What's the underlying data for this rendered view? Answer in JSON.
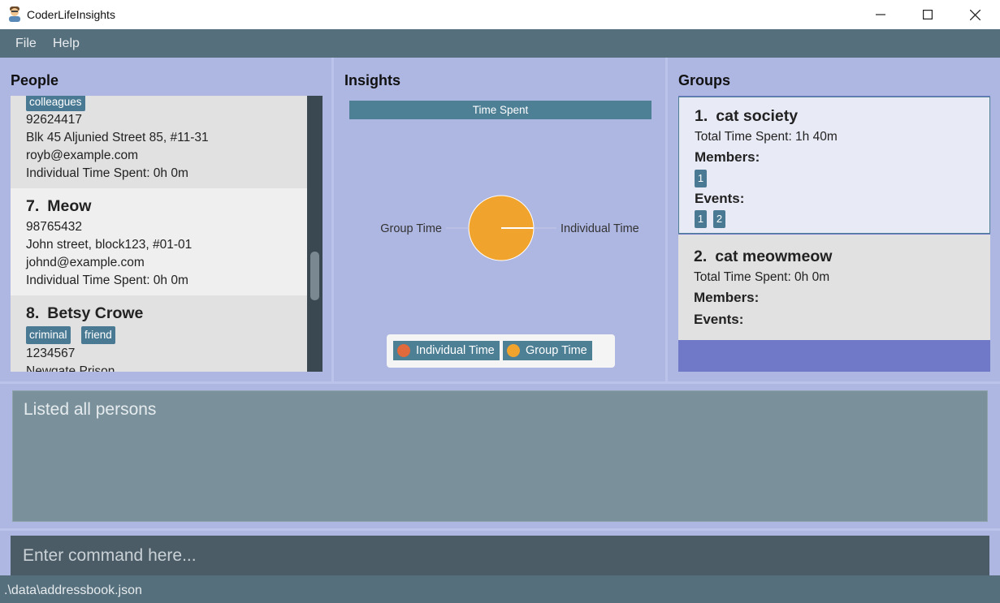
{
  "window": {
    "title": "CoderLifeInsights",
    "icon": "developer-avatar-icon",
    "controls": [
      "minimize-icon",
      "maximize-icon",
      "close-icon"
    ]
  },
  "menu": {
    "file": "File",
    "help": "Help"
  },
  "people": {
    "title": "People",
    "cards": [
      {
        "index": "",
        "name": "",
        "tags": [
          "colleagues"
        ],
        "phone": "92624417",
        "address": "Blk 45 Aljunied Street 85, #11-31",
        "email": "royb@example.com",
        "time": "Individual Time Spent: 0h 0m"
      },
      {
        "index": "7.",
        "name": "Meow",
        "tags": [],
        "phone": "98765432",
        "address": "John street, block123, #01-01",
        "email": "johnd@example.com",
        "time": "Individual Time Spent: 0h 0m"
      },
      {
        "index": "8.",
        "name": "Betsy Crowe",
        "tags": [
          "criminal",
          "friend"
        ],
        "phone": "1234567",
        "address": "Newgate Prison"
      }
    ]
  },
  "insights": {
    "title": "Insights",
    "chart_data": {
      "type": "pie",
      "title": "Time Spent",
      "categories": [
        "Individual Time",
        "Group Time"
      ],
      "values": [
        0,
        1
      ],
      "slice_labels": [
        "Individual Time",
        "Group Time"
      ],
      "legend": [
        "Individual Time",
        "Group Time"
      ],
      "legend_position": "bottom",
      "colors": {
        "Individual Time": "#e06a3b",
        "Group Time": "#f0a42d"
      }
    }
  },
  "groups": {
    "title": "Groups",
    "cards": [
      {
        "index": "1.",
        "name": "cat society",
        "time": "Total Time Spent: 1h 40m",
        "members_label": "Members:",
        "members": [
          "1"
        ],
        "events_label": "Events:",
        "events": [
          "1",
          "2"
        ]
      },
      {
        "index": "2.",
        "name": "cat meowmeow",
        "time": "Total Time Spent: 0h 0m",
        "members_label": "Members:",
        "members": [],
        "events_label": "Events:",
        "events": []
      }
    ]
  },
  "result": {
    "text": "Listed all persons"
  },
  "command": {
    "placeholder": "Enter command here..."
  },
  "status": {
    "path": ".\\data\\addressbook.json"
  },
  "colors": {
    "accent": "#4d7f95",
    "background": "#aeb6e2",
    "menubar": "#566f7c",
    "selected_group": "#e8eaf6"
  }
}
